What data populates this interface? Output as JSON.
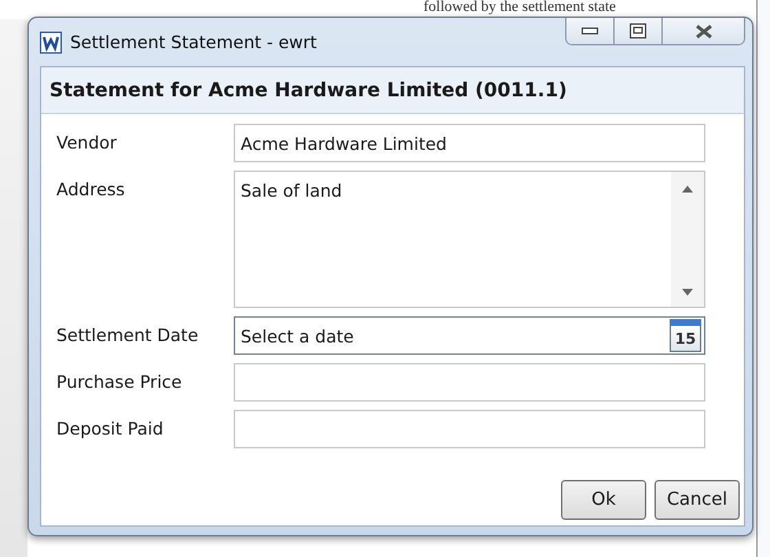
{
  "background_text": "followed by the settlement state",
  "window": {
    "title": "Settlement Statement - ewrt"
  },
  "heading": "Statement for Acme Hardware Limited (0011.1)",
  "fields": [
    {
      "kind": "text",
      "label": "Vendor",
      "value": "Acme Hardware Limited"
    },
    {
      "kind": "multiline",
      "label": "Address",
      "value": "Sale of land"
    },
    {
      "kind": "date",
      "label": "Settlement Date",
      "placeholder": "Select a date",
      "icon_text": "15"
    },
    {
      "kind": "text",
      "label": "Purchase Price"
    },
    {
      "kind": "text",
      "label": "Deposit Paid"
    }
  ],
  "buttons": [
    "Ok",
    "Cancel"
  ]
}
